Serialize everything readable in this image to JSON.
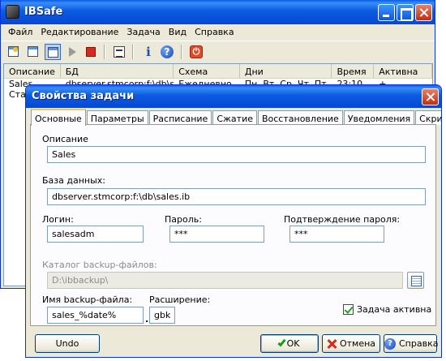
{
  "app": {
    "title": "IBSafe"
  },
  "menu": [
    "Файл",
    "Редактирование",
    "Задача",
    "Вид",
    "Справка"
  ],
  "toolbar": {
    "buttons": [
      "new-task",
      "new-item",
      "edit-task",
      "run-task",
      "stop-task",
      "properties",
      "info",
      "help",
      "shutdown"
    ],
    "help_glyph": "?",
    "info_glyph": "i",
    "power_glyph": "⏻"
  },
  "task_list": {
    "headers": [
      "Описание",
      "БД",
      "Схема",
      "Дни",
      "Время",
      "Активна"
    ],
    "rows": [
      [
        "Sales",
        "dbserver.stmcorp:f:\\db\\sal...",
        "Ежедневно",
        "Пн, Вт, Ср, Чт, Пт",
        "23:10",
        "+"
      ],
      [
        "Стат",
        "",
        "",
        "",
        "",
        ""
      ]
    ]
  },
  "dialog": {
    "title": "Свойства задачи",
    "tabs": [
      "Основные",
      "Параметры",
      "Расписание",
      "Сжатие",
      "Восстановление",
      "Уведомления",
      "Скрипты"
    ],
    "active_tab": "Основные",
    "fields": {
      "description_label": "Описание",
      "description_value": "Sales",
      "database_label": "База данных:",
      "database_value": "dbserver.stmcorp:f:\\db\\sales.ib",
      "login_label": "Логин:",
      "login_value": "salesadm",
      "password_label": "Пароль:",
      "password_value": "***",
      "confirm_label": "Подтверждение пароля:",
      "confirm_value": "***",
      "backup_dir_label": "Каталог backup-файлов:",
      "backup_dir_value": "D:\\ibbackup\\",
      "backup_name_label": "Имя backup-файла:",
      "backup_name_value": "sales_%date%",
      "dot": ".",
      "extension_label": "Расширение:",
      "extension_value": "gbk",
      "active_label": "Задача активна",
      "active_checked": true
    },
    "buttons": {
      "undo": "Undo",
      "ok": "OK",
      "cancel": "Отмена",
      "help": "Справка",
      "help_glyph": "?"
    }
  }
}
